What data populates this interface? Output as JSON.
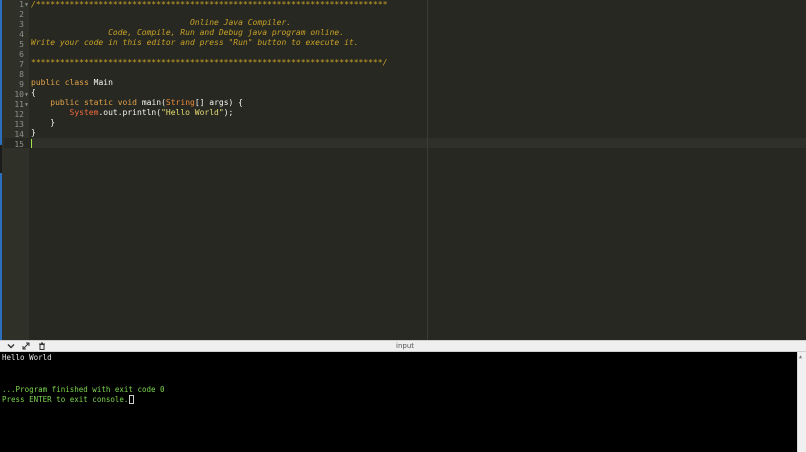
{
  "gutter": {
    "line_numbers": [
      "1",
      "2",
      "3",
      "4",
      "5",
      "6",
      "7",
      "8",
      "9",
      "10",
      "11",
      "12",
      "13",
      "14",
      "15"
    ],
    "fold_markers": [
      "1",
      "10",
      "11"
    ]
  },
  "editor": {
    "comment_line1": "/*************************************************************************",
    "comment_line3": "                                 Online Java Compiler.",
    "comment_line4": "                Code, Compile, Run and Debug java program online.",
    "comment_line5": "Write your code in this editor and press \"Run\" button to execute it.",
    "comment_line7": "*************************************************************************/",
    "kw_public": "public",
    "kw_class": "class",
    "class_name": "Main",
    "open_brace": "{",
    "close_brace": "}",
    "kw_static": "static",
    "kw_void": "void",
    "method_name": "main(",
    "type_string": "String",
    "params": "[] args) {",
    "obj_system": "System",
    "call": ".out.println(",
    "hello_literal": "\"Hello World\"",
    "call_end": ");"
  },
  "toolbar": {
    "collapse_icon": "chevron-down-icon",
    "expand_icon": "expand-icon",
    "clear_icon": "clear-icon",
    "input_tab_label": "input"
  },
  "console": {
    "output_line": "Hello World",
    "finish_line": "...Program finished with exit code 0",
    "prompt_line": "Press ENTER to exit console."
  },
  "colors": {
    "editor_bg": "#272822",
    "comment": "#c9a227",
    "keyword": "#e2a24a",
    "console_green": "#7dd64f"
  }
}
